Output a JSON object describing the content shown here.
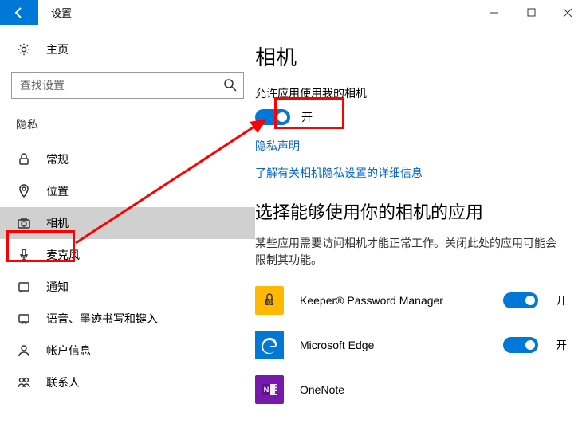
{
  "window": {
    "title": "设置"
  },
  "sidebar": {
    "home_label": "主页",
    "search_placeholder": "查找设置",
    "section_label": "隐私",
    "items": [
      {
        "label": "常规"
      },
      {
        "label": "位置"
      },
      {
        "label": "相机"
      },
      {
        "label": "麦克风"
      },
      {
        "label": "通知"
      },
      {
        "label": "语音、墨迹书写和键入"
      },
      {
        "label": "帐户信息"
      },
      {
        "label": "联系人"
      }
    ]
  },
  "main": {
    "heading": "相机",
    "allow_text": "允许应用使用我的相机",
    "master_toggle_state": "开",
    "privacy_link": "隐私声明",
    "learn_more_link": "了解有关相机隐私设置的详细信息",
    "choose_heading": "选择能够使用你的相机的应用",
    "choose_desc": "某些应用需要访问相机才能正常工作。关闭此处的应用可能会限制其功能。",
    "apps": [
      {
        "name": "Keeper® Password Manager",
        "state": "开"
      },
      {
        "name": "Microsoft Edge",
        "state": "开"
      },
      {
        "name": "OneNote",
        "state": ""
      }
    ]
  }
}
